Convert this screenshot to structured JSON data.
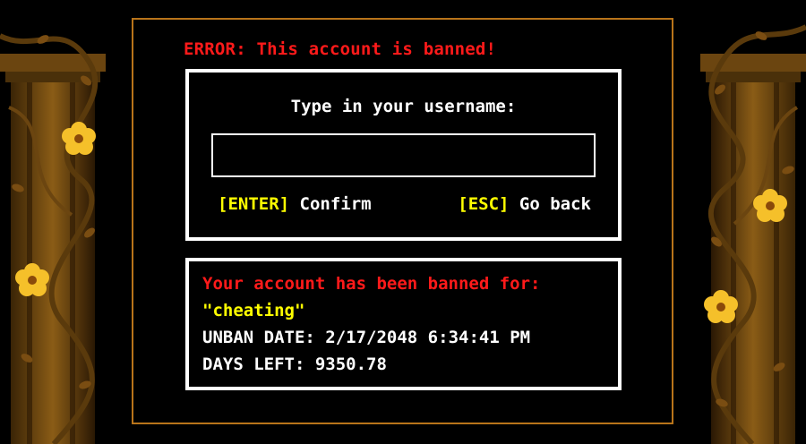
{
  "error_text": "ERROR: This account is banned!",
  "login": {
    "prompt": "Type in your username:",
    "username_value": "",
    "confirm_key": "[ENTER]",
    "confirm_label": "Confirm",
    "back_key": "[ESC]",
    "back_label": "Go back"
  },
  "ban": {
    "heading": "Your account has been banned for:",
    "reason": "\"cheating\"",
    "unban_label": "UNBAN DATE:",
    "unban_date": "2/17/2048 6:34:41 PM",
    "days_left_label": "DAYS LEFT:",
    "days_left": "9350.78"
  },
  "colors": {
    "error_red": "#ff1a1a",
    "key_yellow": "#ffff00",
    "frame_orange": "#b8741a",
    "flower_yellow": "#f5c02a"
  }
}
